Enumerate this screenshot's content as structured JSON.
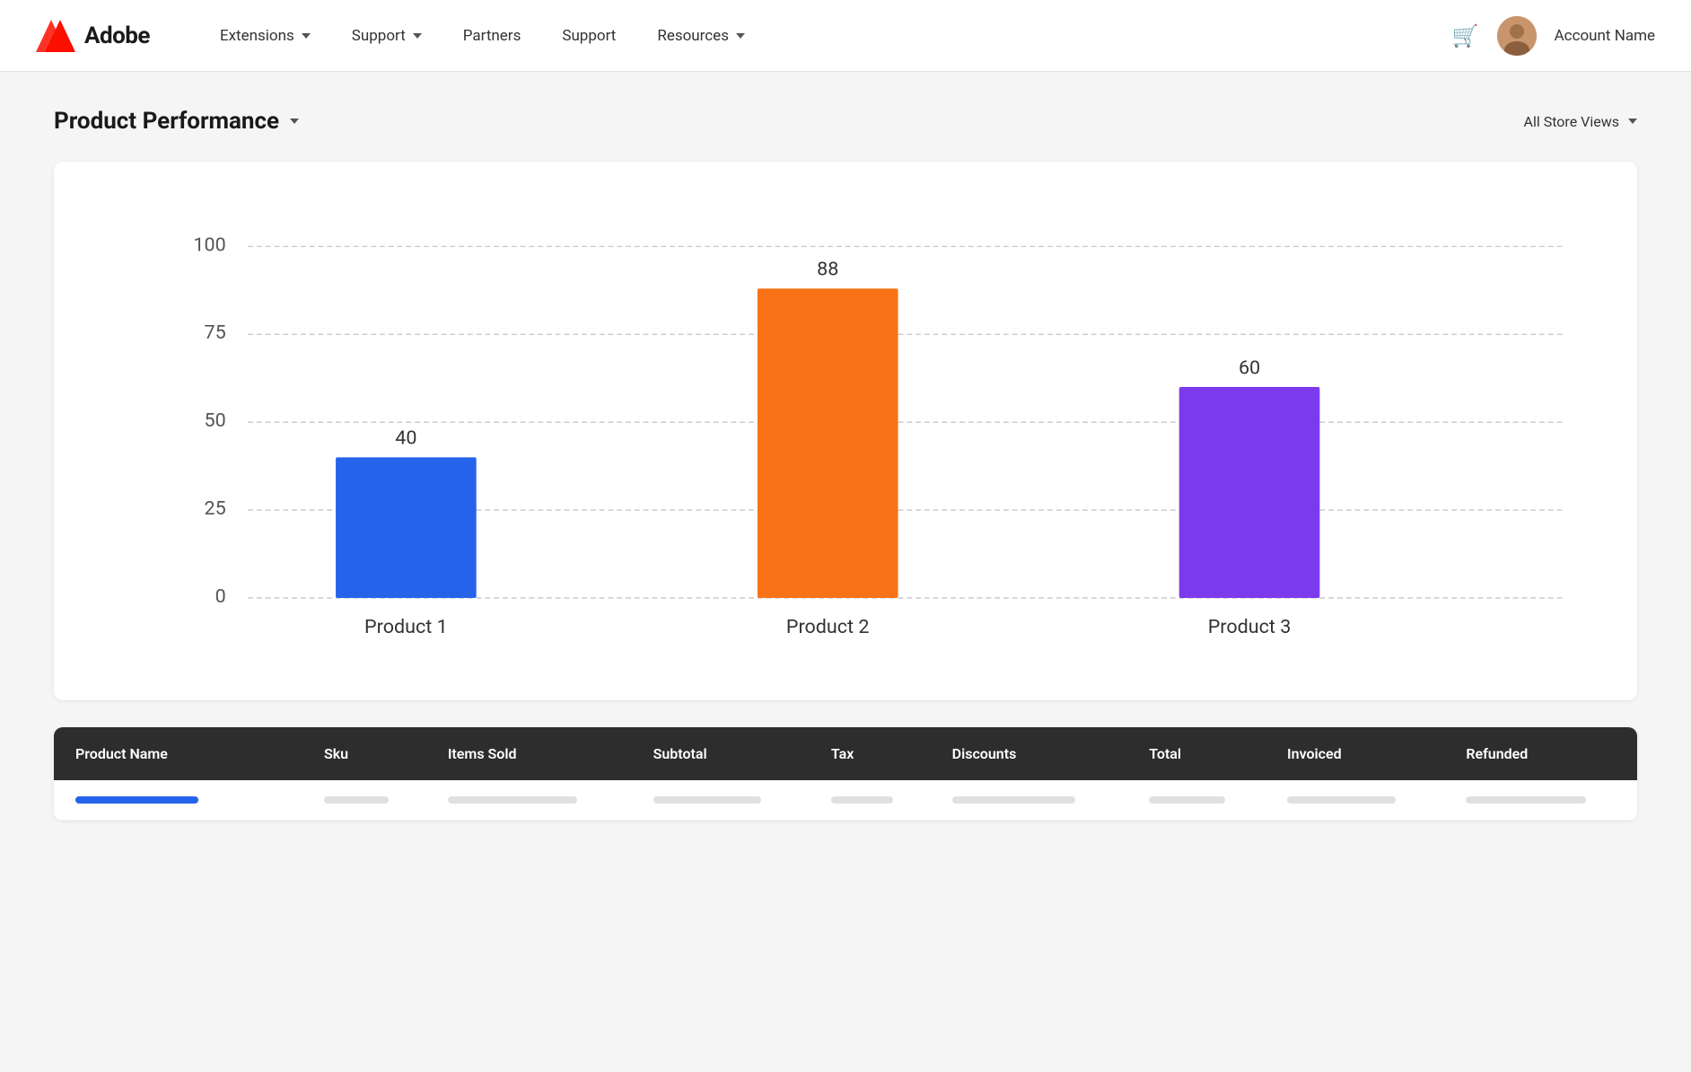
{
  "nav": {
    "logo_text": "Adobe",
    "items": [
      {
        "label": "Extensions",
        "has_dropdown": true
      },
      {
        "label": "Support",
        "has_dropdown": true
      },
      {
        "label": "Partners",
        "has_dropdown": false
      },
      {
        "label": "Support",
        "has_dropdown": false
      },
      {
        "label": "Resources",
        "has_dropdown": true
      }
    ],
    "account_name": "Account Name"
  },
  "page": {
    "title": "Product Performance",
    "store_views": "All Store Views"
  },
  "chart": {
    "y_labels": [
      "100",
      "75",
      "50",
      "25",
      "0"
    ],
    "bars": [
      {
        "label": "Product 1",
        "value": 40,
        "color": "#2563eb"
      },
      {
        "label": "Product 2",
        "value": 88,
        "color": "#f97316"
      },
      {
        "label": "Product 3",
        "value": 60,
        "color": "#7c3aed"
      }
    ],
    "max_value": 100
  },
  "table": {
    "columns": [
      "Product Name",
      "Sku",
      "Items Sold",
      "Subtotal",
      "Tax",
      "Discounts",
      "Total",
      "Invoiced",
      "Refunded"
    ]
  }
}
